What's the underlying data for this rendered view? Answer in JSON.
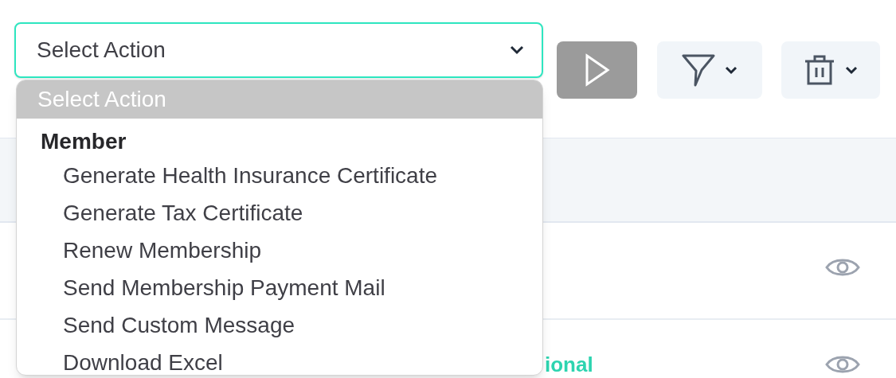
{
  "action_select": {
    "value": "Select Action",
    "expanded": true
  },
  "action_menu": {
    "items": [
      {
        "kind": "placeholder",
        "label": "Select Action",
        "selected": true
      },
      {
        "kind": "group",
        "label": "Member"
      },
      {
        "kind": "option",
        "label": "Generate Health Insurance Certificate",
        "selected": false
      },
      {
        "kind": "option",
        "label": "Generate Tax Certificate",
        "selected": false
      },
      {
        "kind": "option",
        "label": "Renew Membership",
        "selected": false
      },
      {
        "kind": "option",
        "label": "Send Membership Payment Mail",
        "selected": false
      },
      {
        "kind": "option",
        "label": "Send Custom Message",
        "selected": false
      },
      {
        "kind": "option",
        "label": "Download Excel",
        "selected": false
      }
    ]
  },
  "table": {
    "rows": [
      {
        "view_icon": true
      },
      {
        "view_icon": true,
        "column_2": "ional"
      }
    ]
  }
}
